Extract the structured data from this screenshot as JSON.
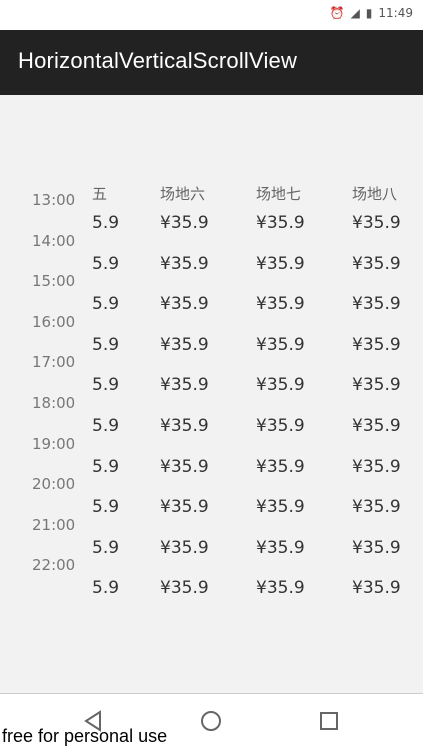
{
  "status": {
    "time": "11:49"
  },
  "app": {
    "title": "HorizontalVerticalScrollView"
  },
  "headers": [
    "场地五",
    "场地六",
    "场地七",
    "场地八"
  ],
  "times": [
    "13:00",
    "14:00",
    "15:00",
    "16:00",
    "17:00",
    "18:00",
    "19:00",
    "20:00",
    "21:00",
    "22:00"
  ],
  "price": "¥35.9",
  "price_partial": "5.9",
  "watermark": "free for personal use",
  "nav": {
    "back": "back-icon",
    "home": "home-icon",
    "recents": "recents-icon"
  }
}
